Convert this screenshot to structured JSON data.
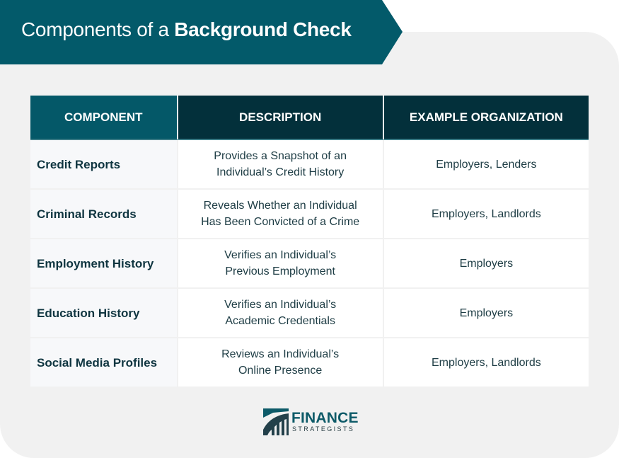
{
  "header": {
    "title_regular": "Components of a ",
    "title_bold": "Background Check"
  },
  "colors": {
    "banner": "#035a6a",
    "header_col1": "#045868",
    "header_dark": "#03303b",
    "panel_bg": "#f1f1f1"
  },
  "table": {
    "columns": [
      "COMPONENT",
      "DESCRIPTION",
      "EXAMPLE ORGANIZATION"
    ],
    "rows": [
      {
        "component": "Credit Reports",
        "desc1": "Provides a Snapshot of an",
        "desc2": "Individual’s Credit History",
        "org": "Employers, Lenders"
      },
      {
        "component": "Criminal Records",
        "desc1": "Reveals Whether an Individual",
        "desc2": "Has Been Convicted of a Crime",
        "org": "Employers, Landlords"
      },
      {
        "component": "Employment History",
        "desc1": "Verifies an Individual’s",
        "desc2": "Previous Employment",
        "org": "Employers"
      },
      {
        "component": "Education History",
        "desc1": "Verifies an Individual’s",
        "desc2": "Academic Credentials",
        "org": "Employers"
      },
      {
        "component": "Social Media Profiles",
        "desc1": "Reviews an Individual’s",
        "desc2": "Online Presence",
        "org": "Employers, Landlords"
      }
    ]
  },
  "logo": {
    "line1": "FINANCE",
    "line2": "STRATEGISTS",
    "icon": "finance-strategists-logo-icon"
  }
}
